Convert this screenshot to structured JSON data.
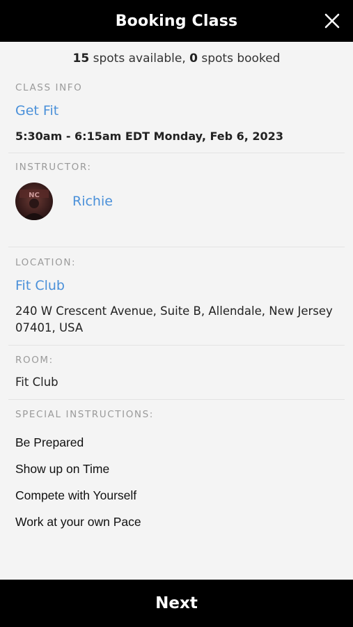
{
  "header": {
    "title": "Booking Class",
    "close_icon": "close-icon"
  },
  "availability": {
    "spots_available": "15",
    "available_suffix": " spots available, ",
    "spots_booked": "0",
    "booked_suffix": " spots booked"
  },
  "class_info": {
    "label": "CLASS INFO",
    "name": "Get Fit",
    "datetime": "5:30am - 6:15am EDT Monday, Feb 6, 2023"
  },
  "instructor": {
    "label": "INSTRUCTOR:",
    "name": "Richie"
  },
  "location": {
    "label": "LOCATION:",
    "name": "Fit Club",
    "address_line1": "240 W Crescent Avenue, Suite B, Allendale, New Jersey",
    "address_line2": "07401, USA"
  },
  "room": {
    "label": "ROOM:",
    "name": "Fit Club"
  },
  "special_instructions": {
    "label": "SPECIAL INSTRUCTIONS:",
    "items": [
      "Be Prepared",
      "Show up on Time",
      "Compete with Yourself",
      "Work at your own Pace"
    ]
  },
  "footer": {
    "next_label": "Next"
  },
  "colors": {
    "link": "#4a90d9",
    "header_bg": "#000000",
    "page_bg": "#f4f4f4"
  }
}
